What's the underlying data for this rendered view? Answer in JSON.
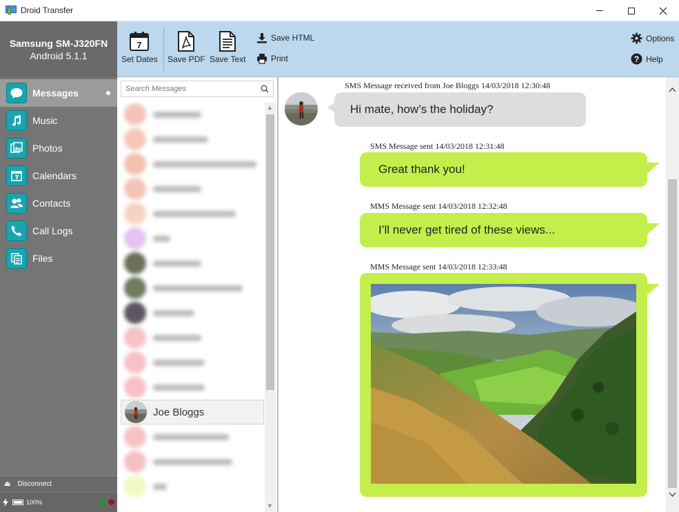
{
  "window": {
    "title": "Droid Transfer"
  },
  "device": {
    "name": "Samsung SM-J320FN",
    "os": "Android 5.1.1"
  },
  "nav": [
    {
      "label": "Messages",
      "icon": "speech-bubble-icon",
      "active": true
    },
    {
      "label": "Music",
      "icon": "music-note-icon"
    },
    {
      "label": "Photos",
      "icon": "photos-icon"
    },
    {
      "label": "Calendars",
      "icon": "calendar-icon"
    },
    {
      "label": "Contacts",
      "icon": "contacts-icon"
    },
    {
      "label": "Call Logs",
      "icon": "phone-icon"
    },
    {
      "label": "Files",
      "icon": "files-icon"
    }
  ],
  "footer": {
    "disconnect": "Disconnect",
    "battery": "100%"
  },
  "toolbar": {
    "set_dates": "Set Dates",
    "calendar_day": "7",
    "save_pdf": "Save PDF",
    "save_text": "Save Text",
    "save_html": "Save HTML",
    "print": "Print",
    "options": "Options",
    "help": "Help"
  },
  "search": {
    "placeholder": "Search Messages"
  },
  "contacts": {
    "selected_name": "Joe Bloggs"
  },
  "messages": [
    {
      "direction": "received",
      "header": "SMS Message received from Joe Bloggs     14/03/2018 12:30:48",
      "text": "Hi mate, how’s the holiday?"
    },
    {
      "direction": "sent",
      "header": "SMS Message sent 14/03/2018 12:31:48",
      "text": "Great thank you!"
    },
    {
      "direction": "sent",
      "header": "MMS Message sent 14/03/2018 12:32:48",
      "text": "I’ll never get tired of these views..."
    },
    {
      "direction": "sent",
      "header": "MMS Message sent 14/03/2018 12:33:48",
      "text": ""
    }
  ],
  "colors": {
    "sent_bubble": "#c4ef4a",
    "received_bubble": "#dddddd",
    "nav_bg": "#757575",
    "toolbar_bg": "#bcd8ee",
    "nav_icon": "#18a5b0"
  }
}
